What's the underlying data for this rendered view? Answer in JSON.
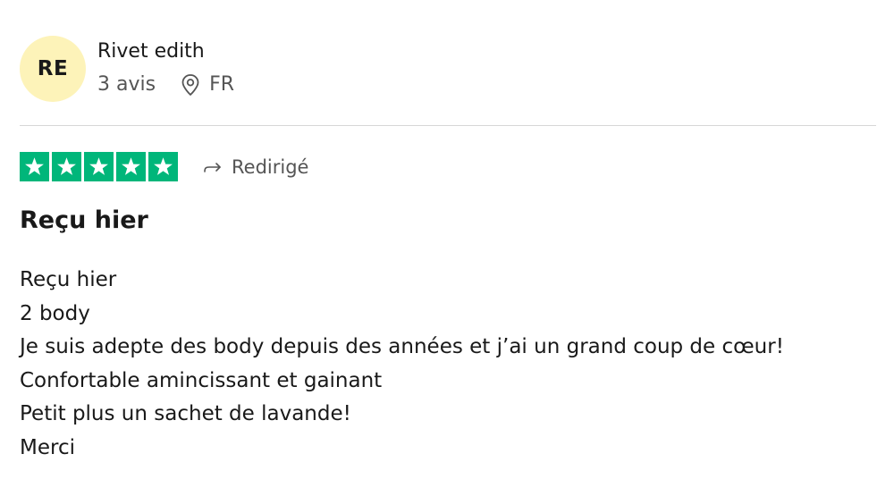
{
  "consumer": {
    "initials": "RE",
    "name": "Rivet edith",
    "reviews_count": "3 avis",
    "country": "FR"
  },
  "rating": {
    "stars": 5,
    "max_stars": 5,
    "star_color": "#00b67a",
    "redirect_label": "Redirigé"
  },
  "review": {
    "title": "Reçu hier",
    "lines": [
      "Reçu hier",
      "2 body",
      "Je suis adepte des body depuis des années et j’ai un grand coup de cœur!",
      "Confortable amincissant et gainant",
      "Petit plus un sachet de lavande!",
      "Merci"
    ]
  },
  "colors": {
    "avatar_bg": "#fdf3b9",
    "text": "#191919",
    "muted": "#555555",
    "divider": "#d6d6d6"
  }
}
